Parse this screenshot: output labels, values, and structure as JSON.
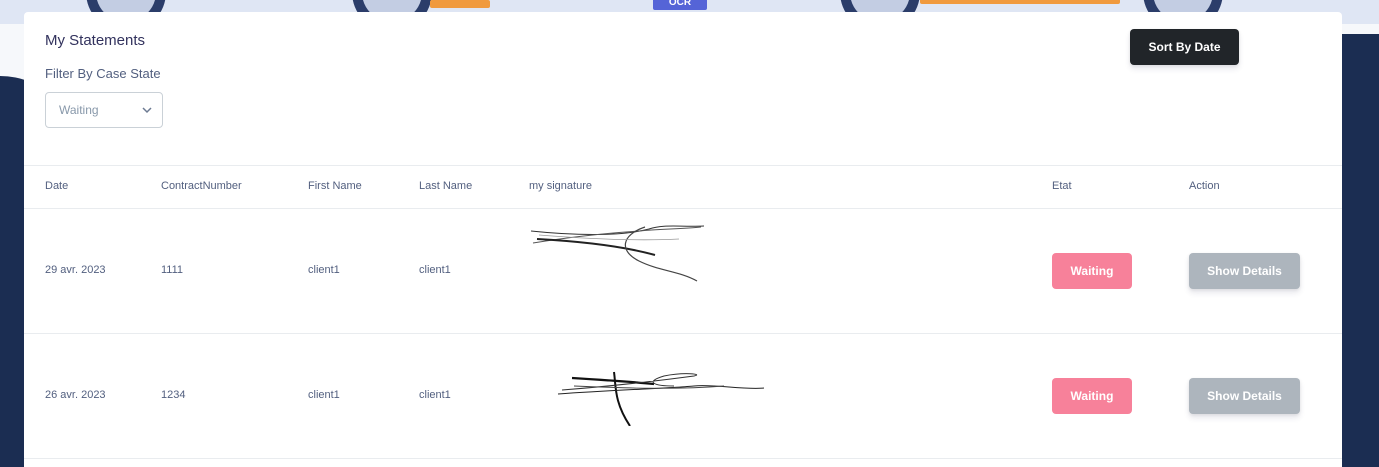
{
  "header": {
    "banner_badge": "OCR"
  },
  "page": {
    "title": "My Statements",
    "filter_label": "Filter By Case State",
    "filter_value": "Waiting",
    "sort_button": "Sort By Date"
  },
  "table": {
    "columns": [
      "Date",
      "ContractNumber",
      "First Name",
      "Last Name",
      "my signature",
      "Etat",
      "Action"
    ],
    "rows": [
      {
        "date": "29 avr. 2023",
        "contract": "1111",
        "first_name": "client1",
        "last_name": "client1",
        "etat": "Waiting",
        "action": "Show Details"
      },
      {
        "date": "26 avr. 2023",
        "contract": "1234",
        "first_name": "client1",
        "last_name": "client1",
        "etat": "Waiting",
        "action": "Show Details"
      }
    ]
  },
  "colors": {
    "navy": "#1b2d52",
    "waiting_badge": "#f7819a",
    "details_button": "#adb5bd",
    "sort_button": "#212529"
  }
}
